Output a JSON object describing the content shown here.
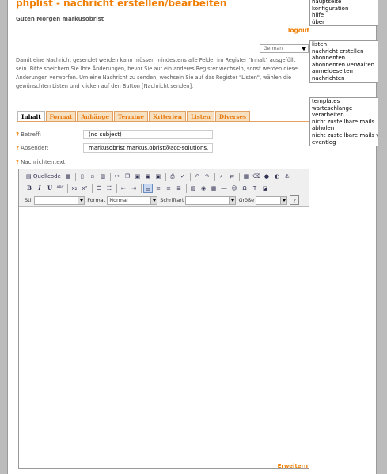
{
  "header": {
    "title": "phplist - nachricht erstellen/bearbeiten",
    "greeting": "Guten Morgen markusobrist",
    "logout": "logout"
  },
  "language": {
    "selected": "German"
  },
  "info_text": "Damit eine Nachricht gesendet werden kann müssen mindestens alle Felder im Register \"Inhalt\" ausgefüllt sein. Bitte speichern Sie Ihre Änderungen, bevor Sie auf ein anderes Register wechseln, sonst werden diese Änderungen verworfen. Um eine Nachricht zu senden, wechseln Sie auf das Register \"Listen\", wählen die gewünschten Listen und klicken auf den Button [Nachricht senden].",
  "tabs": [
    {
      "label": "Inhalt",
      "active": true
    },
    {
      "label": "Format"
    },
    {
      "label": "Anhänge"
    },
    {
      "label": "Termine"
    },
    {
      "label": "Kriterien"
    },
    {
      "label": "Listen"
    },
    {
      "label": "Diverses"
    }
  ],
  "form": {
    "subject_label": "Betreff:",
    "subject_value": "(no subject)",
    "sender_label": "Absender:",
    "sender_value": "markusobrist markus.obrist@acc-solutions.",
    "message_label": "Nachrichtentext.",
    "help_marker": "?"
  },
  "editor": {
    "source_label": "Quellcode",
    "style_label": "Stil",
    "format_label": "Format",
    "format_value": "Normal",
    "font_label": "Schriftart",
    "size_label": "Größe",
    "bold": "B",
    "italic": "I",
    "underline": "U",
    "strike": "ABC",
    "expand_link": "Erweitern"
  },
  "sidebar": {
    "group1": [
      "hauptseite",
      "konfiguration",
      "hilfe",
      "über"
    ],
    "group2": [
      "listen",
      "nachricht erstellen",
      "abonnenten",
      "abonnenten verwalten",
      "anmeldeseiten",
      "nachrichten"
    ],
    "group3": [
      "templates",
      "warteschlange",
      "verarbeiten",
      "nicht zustellbare mails",
      "abholen",
      "nicht zustellbare mails verarbeiten",
      "eventlog"
    ]
  },
  "colors": {
    "accent": "#f07d00",
    "background": "#bcbcbc"
  }
}
